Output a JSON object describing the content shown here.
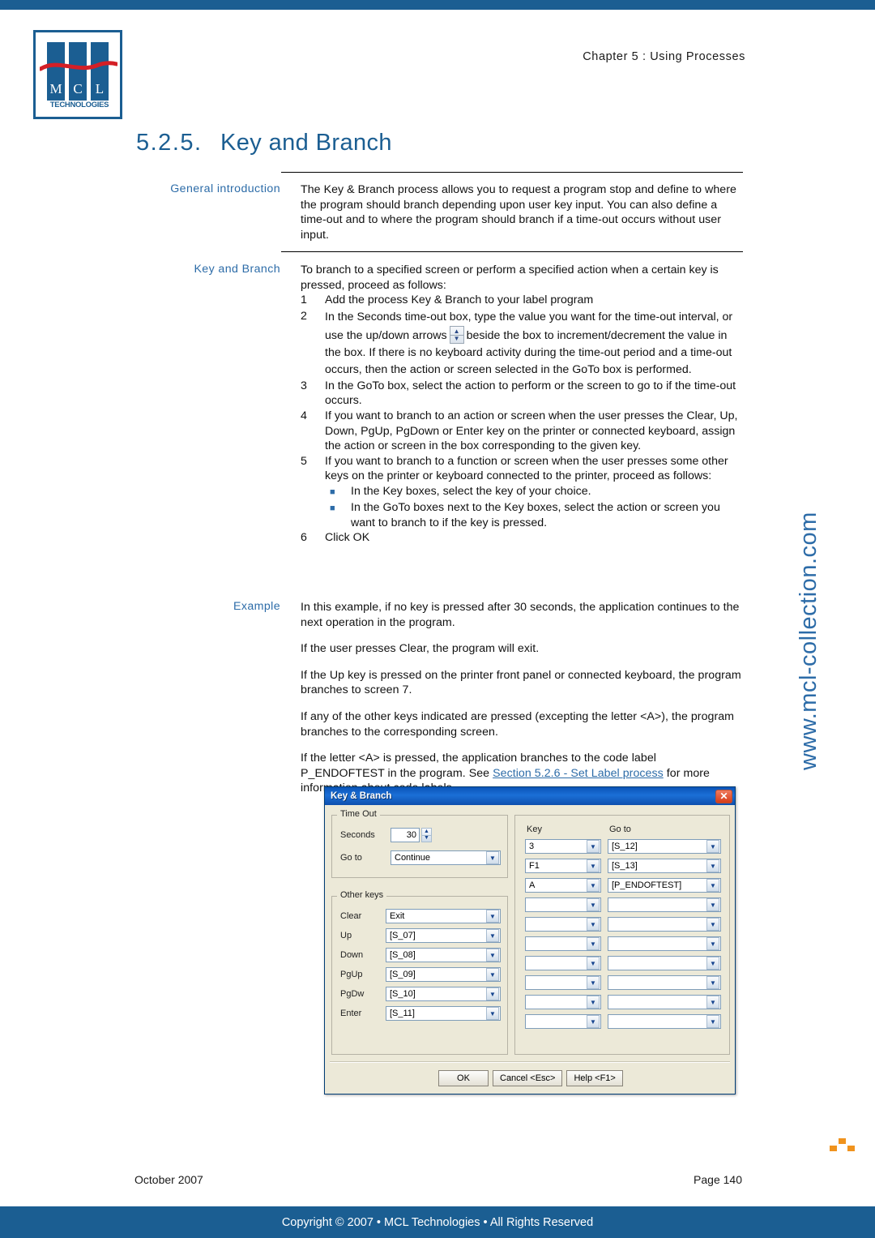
{
  "top_bar_color": "#1b5e92",
  "accent_color": "#2d6ca8",
  "logo": {
    "letters": [
      "M",
      "C",
      "L"
    ],
    "subtitle": "TECHNOLOGIES"
  },
  "header": {
    "chapter": "Chapter 5 : Using Processes"
  },
  "title": {
    "number": "5.2.5.",
    "text": "Key and Branch"
  },
  "sections": {
    "general": {
      "label": "General introduction",
      "body": "The Key & Branch process allows you to request a program stop and define to where the program should branch depending upon user key input. You can also define a time-out and to where the program should branch if a time-out occurs without user input."
    },
    "procedure": {
      "label": "Key and Branch",
      "intro": "To branch to a specified screen or perform a specified action when a certain key is pressed, proceed as follows:",
      "steps": [
        {
          "n": "1",
          "text": "Add the process Key & Branch to your label program"
        },
        {
          "n": "2",
          "text_before": "In the Seconds time-out box, type the value you want for the time-out interval, or use the up/down arrows",
          "text_after": "beside the box to increment/decrement the value in the box. If there is no keyboard activity during the time-out period and a time-out occurs, then the action or screen selected in the GoTo box is performed."
        },
        {
          "n": "3",
          "text": "In the GoTo box, select the action to perform or the screen to go to if the time-out occurs."
        },
        {
          "n": "4",
          "text": "If you want to branch to an action or screen when the user presses the Clear, Up, Down, PgUp, PgDown or Enter key on the printer or connected keyboard, assign the action or screen in the box corresponding to the given key."
        },
        {
          "n": "5",
          "text": "If you want to branch to a function or screen when the user presses some other keys on the printer or keyboard connected to the printer, proceed as follows:"
        },
        {
          "n": "6",
          "text": "Click OK"
        }
      ],
      "substeps": [
        "In the Key boxes, select the key of your choice.",
        "In the GoTo boxes next to the Key boxes, select the action or screen you want to branch to if the key is pressed."
      ]
    },
    "example": {
      "label": "Example",
      "paragraphs": [
        "In this example, if no key is pressed after 30 seconds, the application continues to the next operation in the program.",
        "If the user presses Clear, the program will exit.",
        "If the Up key is pressed on the printer front panel or connected keyboard, the program branches to screen 7.",
        "If any of the other keys indicated are pressed (excepting the letter <A>), the program branches to the corresponding screen."
      ],
      "last_paragraph": {
        "before": "If the letter <A> is pressed, the application branches to the code label P_ENDOFTEST in the program. See ",
        "link": "Section 5.2.6 - Set Label process",
        "after": " for more information about code labels."
      }
    }
  },
  "dialog": {
    "title": "Key & Branch",
    "close_icon": "✕",
    "time_out": {
      "legend": "Time Out",
      "seconds_label": "Seconds",
      "seconds_value": "30",
      "goto_label": "Go to",
      "goto_value": "Continue"
    },
    "other_keys": {
      "legend": "Other keys",
      "rows": [
        {
          "label": "Clear",
          "value": "Exit"
        },
        {
          "label": "Up",
          "value": "[S_07]"
        },
        {
          "label": "Down",
          "value": "[S_08]"
        },
        {
          "label": "PgUp",
          "value": "[S_09]"
        },
        {
          "label": "PgDw",
          "value": "[S_10]"
        },
        {
          "label": "Enter",
          "value": "[S_11]"
        }
      ]
    },
    "key_table": {
      "key_header": "Key",
      "goto_header": "Go to",
      "rows": [
        {
          "key": "3",
          "goto": "[S_12]"
        },
        {
          "key": "F1",
          "goto": "[S_13]"
        },
        {
          "key": "A",
          "goto": "[P_ENDOFTEST]"
        },
        {
          "key": "",
          "goto": ""
        },
        {
          "key": "",
          "goto": ""
        },
        {
          "key": "",
          "goto": ""
        },
        {
          "key": "",
          "goto": ""
        },
        {
          "key": "",
          "goto": ""
        },
        {
          "key": "",
          "goto": ""
        },
        {
          "key": "",
          "goto": ""
        }
      ]
    },
    "buttons": {
      "ok": "OK",
      "cancel": "Cancel <Esc>",
      "help": "Help <F1>"
    }
  },
  "watermark": {
    "text": "www.mcl-collection.com"
  },
  "footer": {
    "date": "October 2007",
    "page": "Page 140",
    "copyright": "Copyright © 2007 • MCL Technologies • All Rights Reserved"
  }
}
